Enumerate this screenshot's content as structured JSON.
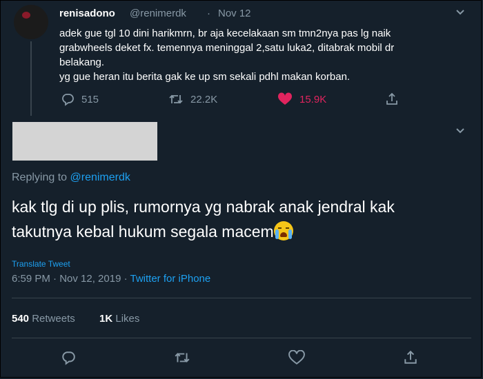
{
  "parent_tweet": {
    "name": "renisadono",
    "handle": "@renimerdk",
    "separator": "·",
    "date": "Nov 12",
    "lines": [
      "adek gue tgl 10 dini harikmrn, br aja kecelakaan sm tmn2nya pas lg naik",
      "grabwheels deket fx. temennya meninggal 2,satu luka2, ditabrak mobil dr",
      "belakang.",
      "yg gue heran itu berita gak ke up sm sekali pdhl makan korban."
    ],
    "actions": {
      "replies": "515",
      "retweets": "22.2K",
      "likes": "15.9K"
    }
  },
  "reply_tweet": {
    "replying_to_prefix": "Replying to",
    "replying_to_handle": "@renimerdk",
    "text_lines": [
      "kak tlg di up plis, rumornya yg nabrak anak jendral kak",
      "takutnya kebal hukum segala macem"
    ],
    "translate_label": "Translate Tweet",
    "timestamp": "6:59 PM · Nov 12, 2019 ·",
    "source": "Twitter for iPhone",
    "retweet_count": "540",
    "retweet_label": "Retweets",
    "like_count": "1K",
    "like_label": "Likes"
  },
  "icons": {
    "reply": "reply-icon",
    "retweet": "retweet-icon",
    "like": "heart-icon",
    "share": "share-icon",
    "menu": "chevron-down-icon",
    "emoji": "loudly-crying-face-emoji"
  },
  "colors": {
    "background": "#15202b",
    "text": "#ffffff",
    "muted": "#8899a6",
    "link": "#1da1f2",
    "like": "#e0245e",
    "divider": "#38444d"
  }
}
